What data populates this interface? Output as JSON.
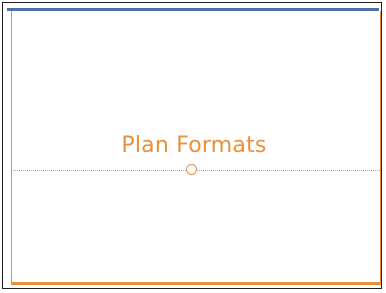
{
  "slide": {
    "title": "Plan Formats"
  },
  "theme": {
    "top_accent_color": "#4f6fa8",
    "accent_color": "#e8913a",
    "frame_color": "#1f1f1f",
    "background": "#ffffff"
  }
}
